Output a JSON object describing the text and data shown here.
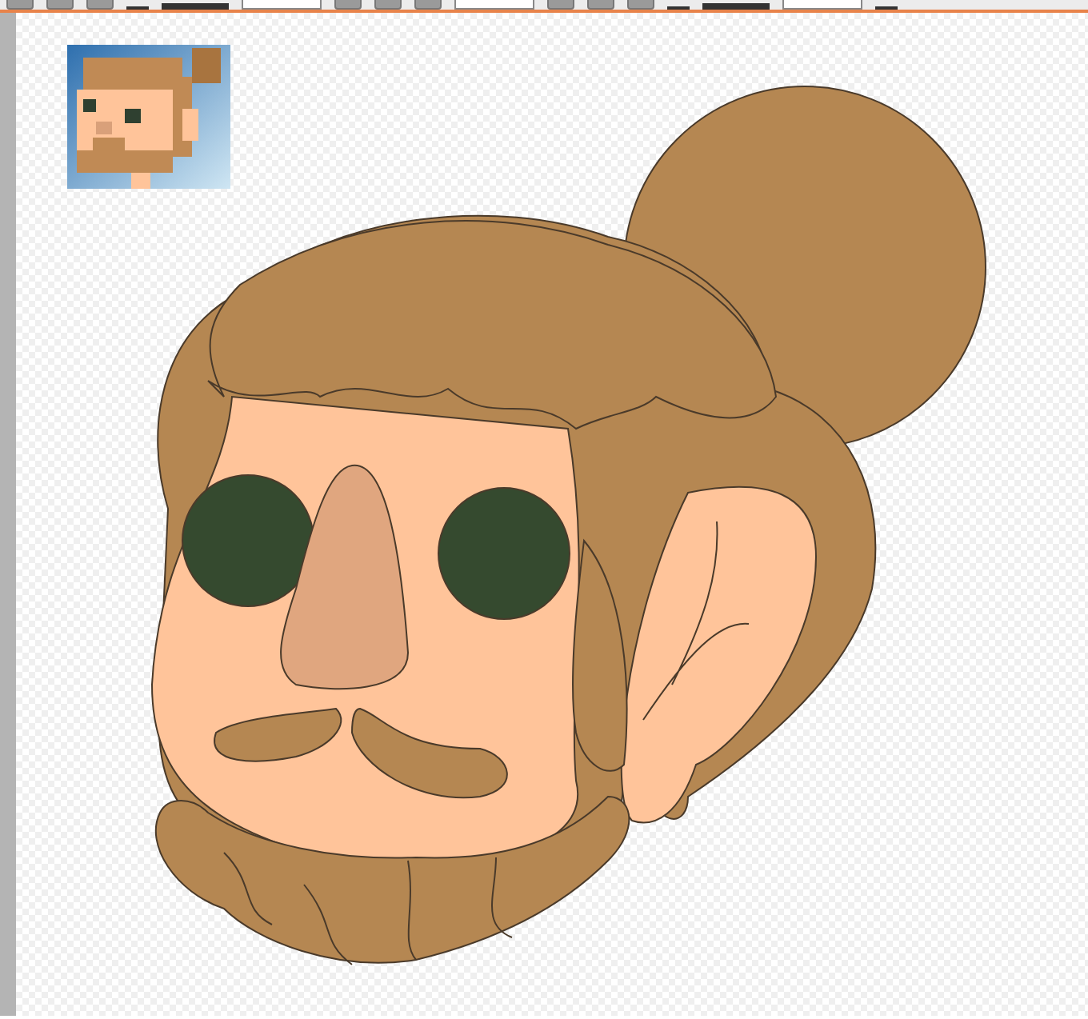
{
  "toolbar": [
    {
      "kind": "button"
    },
    {
      "kind": "button"
    },
    {
      "kind": "button"
    },
    {
      "kind": "icon"
    },
    {
      "kind": "label"
    },
    {
      "kind": "field"
    },
    {
      "kind": "button"
    },
    {
      "kind": "button"
    },
    {
      "kind": "button"
    },
    {
      "kind": "field"
    },
    {
      "kind": "button"
    },
    {
      "kind": "button"
    },
    {
      "kind": "button"
    },
    {
      "kind": "icon"
    },
    {
      "kind": "label"
    },
    {
      "kind": "field"
    },
    {
      "kind": "icon"
    }
  ]
}
